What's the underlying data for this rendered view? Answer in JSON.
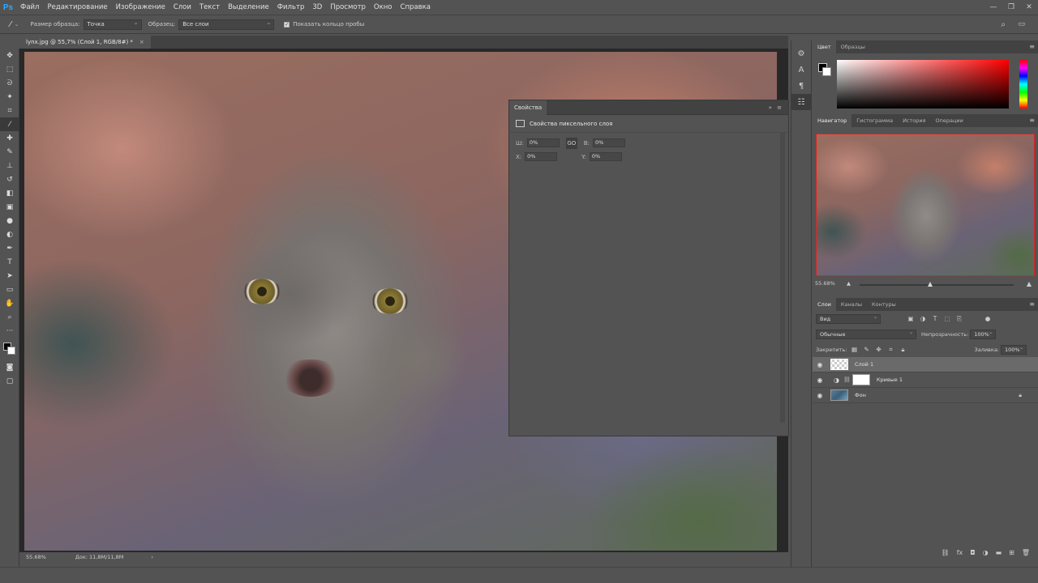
{
  "app": {
    "logo": "Ps"
  },
  "menu": [
    "Файл",
    "Редактирование",
    "Изображение",
    "Слои",
    "Текст",
    "Выделение",
    "Фильтр",
    "3D",
    "Просмотр",
    "Окно",
    "Справка"
  ],
  "window_controls": [
    "—",
    "❐",
    "✕"
  ],
  "options": {
    "tool_icon": "eyedropper-icon",
    "sample_size_label": "Размер образца:",
    "sample_size_value": "Точка",
    "sample_label": "Образец:",
    "sample_value": "Все слои",
    "show_ring_label": "Показать кольцо пробы",
    "show_ring_checked": true
  },
  "document": {
    "tab_title": "lynx.jpg @ 55,7% (Слой 1, RGB/8#) *",
    "close": "×"
  },
  "properties": {
    "tab": "Свойства",
    "panel_controls": "»  ≡",
    "title": "Свойства пиксельного слоя",
    "w_label": "Ш:",
    "w_value": "0%",
    "h_label": "В:",
    "h_value": "0%",
    "x_label": "X:",
    "x_value": "0%",
    "y_label": "Y:",
    "y_value": "0%",
    "link": "GO"
  },
  "color_panel": {
    "tabs": [
      "Цвет",
      "Образцы"
    ],
    "hue_color": "#ff0000"
  },
  "navigator": {
    "tabs": [
      "Навигатор",
      "Гистограмма",
      "История",
      "Операции"
    ],
    "zoom_text": "55.68%",
    "zoom_fraction": 0.46
  },
  "layers_panel": {
    "tabs": [
      "Слои",
      "Каналы",
      "Контуры"
    ],
    "filter_value": "Вид",
    "blend_mode": "Обычные",
    "opacity_label": "Непрозрачность:",
    "opacity_value": "100%",
    "lock_label": "Закрепить:",
    "fill_label": "Заливка:",
    "fill_value": "100%",
    "layers": [
      {
        "name": "Слой 1",
        "selected": true,
        "thumb": "checker"
      },
      {
        "name": "Кривые 1",
        "selected": false,
        "thumb": "mask"
      },
      {
        "name": "Фон",
        "selected": false,
        "thumb": "photo",
        "locked": true
      }
    ],
    "footer_icons": [
      "link-icon",
      "fx-icon",
      "mask-icon",
      "adjustment-icon",
      "folder-icon",
      "new-layer-icon",
      "trash-icon"
    ]
  },
  "status": {
    "zoom": "55.68%",
    "doc": "Док: 11,8M/11,8M"
  }
}
